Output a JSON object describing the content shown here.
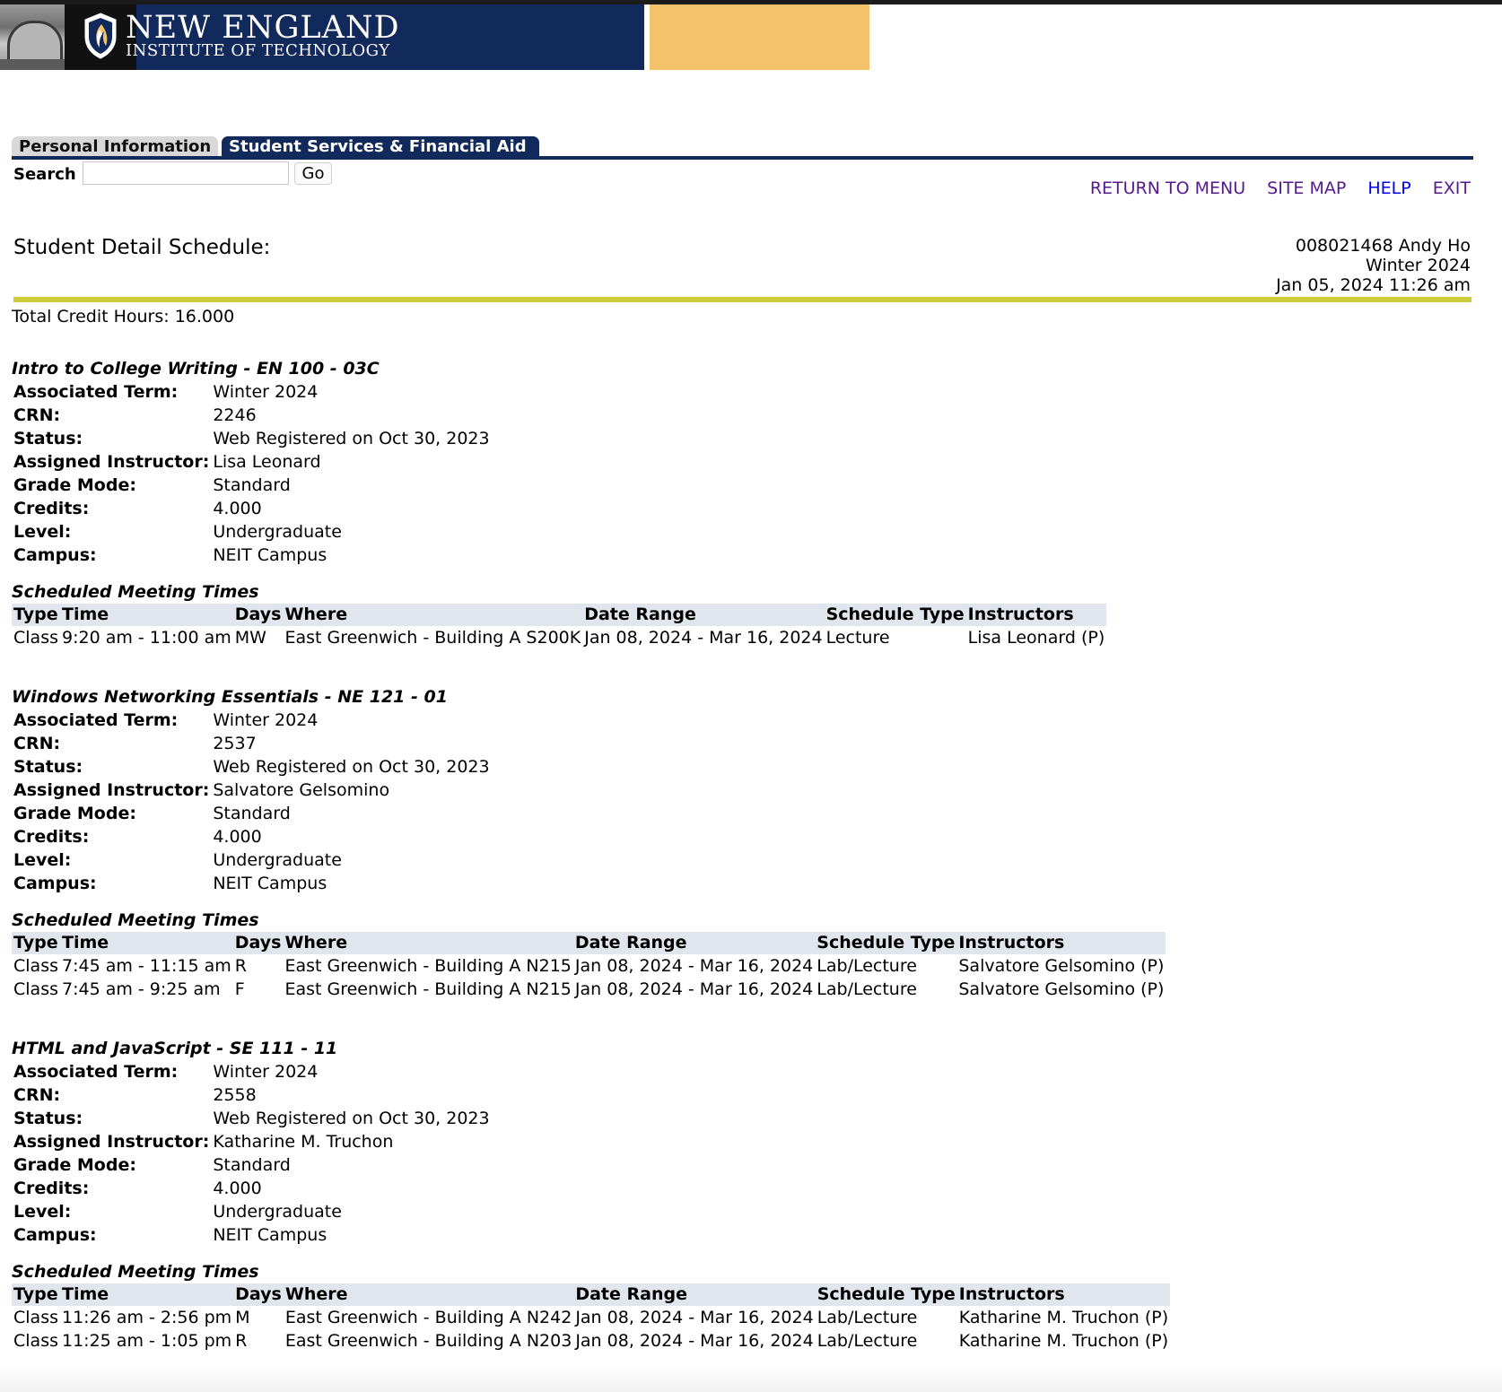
{
  "banner": {
    "title": "NEW ENGLAND",
    "subtitle": "INSTITUTE OF TECHNOLOGY",
    "colors": {
      "navy": "#12295b",
      "gold": "#f3c36b"
    }
  },
  "tabs": [
    {
      "label": "Personal Information",
      "active": false
    },
    {
      "label": "Student Services & Financial Aid",
      "active": true
    }
  ],
  "search": {
    "label": "Search",
    "value": "",
    "go_label": "Go"
  },
  "nav_links": [
    {
      "label": "RETURN TO MENU"
    },
    {
      "label": "SITE MAP"
    },
    {
      "label": "HELP"
    },
    {
      "label": "EXIT"
    }
  ],
  "page": {
    "title": "Student Detail Schedule:",
    "student_line": "008021468 Andy Ho",
    "term": "Winter 2024",
    "timestamp": "Jan 05, 2024 11:26 am",
    "total_credits": "Total Credit Hours: 16.000"
  },
  "detail_labels": {
    "term": "Associated Term:",
    "crn": "CRN:",
    "status": "Status:",
    "instructor": "Assigned Instructor:",
    "grade_mode": "Grade Mode:",
    "credits": "Credits:",
    "level": "Level:",
    "campus": "Campus:"
  },
  "meeting_section_title": "Scheduled Meeting Times",
  "meeting_headers": {
    "type": "Type",
    "time": "Time",
    "days": "Days",
    "where": "Where",
    "date_range": "Date Range",
    "schedule_type": "Schedule Type",
    "instructors": "Instructors"
  },
  "courses": [
    {
      "title": "Intro to College Writing - EN 100 - 03C",
      "term": "Winter 2024",
      "crn": "2246",
      "status": "Web Registered on Oct 30, 2023",
      "instructor": "Lisa Leonard",
      "grade_mode": "Standard",
      "credits": "4.000",
      "level": "Undergraduate",
      "campus": "NEIT Campus",
      "meetings": [
        {
          "type": "Class",
          "time": "9:20 am - 11:00 am",
          "days": "MW",
          "where": "East Greenwich - Building A S200K",
          "date_range": "Jan 08, 2024 - Mar 16, 2024",
          "schedule_type": "Lecture",
          "instructors": "Lisa Leonard (P)"
        }
      ]
    },
    {
      "title": "Windows Networking Essentials - NE 121 - 01",
      "term": "Winter 2024",
      "crn": "2537",
      "status": "Web Registered on Oct 30, 2023",
      "instructor": "Salvatore Gelsomino",
      "grade_mode": "Standard",
      "credits": "4.000",
      "level": "Undergraduate",
      "campus": "NEIT Campus",
      "meetings": [
        {
          "type": "Class",
          "time": "7:45 am - 11:15 am",
          "days": "R",
          "where": "East Greenwich - Building A N215",
          "date_range": "Jan 08, 2024 - Mar 16, 2024",
          "schedule_type": "Lab/Lecture",
          "instructors": "Salvatore Gelsomino (P)"
        },
        {
          "type": "Class",
          "time": "7:45 am - 9:25 am",
          "days": "F",
          "where": "East Greenwich - Building A N215",
          "date_range": "Jan 08, 2024 - Mar 16, 2024",
          "schedule_type": "Lab/Lecture",
          "instructors": "Salvatore Gelsomino (P)"
        }
      ]
    },
    {
      "title": "HTML and JavaScript - SE 111 - 11",
      "term": "Winter 2024",
      "crn": "2558",
      "status": "Web Registered on Oct 30, 2023",
      "instructor": "Katharine M. Truchon",
      "grade_mode": "Standard",
      "credits": "4.000",
      "level": "Undergraduate",
      "campus": "NEIT Campus",
      "meetings": [
        {
          "type": "Class",
          "time": "11:26 am - 2:56 pm",
          "days": "M",
          "where": "East Greenwich - Building A N242",
          "date_range": "Jan 08, 2024 - Mar 16, 2024",
          "schedule_type": "Lab/Lecture",
          "instructors": "Katharine M. Truchon (P)"
        },
        {
          "type": "Class",
          "time": "11:25 am - 1:05 pm",
          "days": "R",
          "where": "East Greenwich - Building A N203",
          "date_range": "Jan 08, 2024 - Mar 16, 2024",
          "schedule_type": "Lab/Lecture",
          "instructors": "Katharine M. Truchon (P)"
        }
      ]
    }
  ]
}
